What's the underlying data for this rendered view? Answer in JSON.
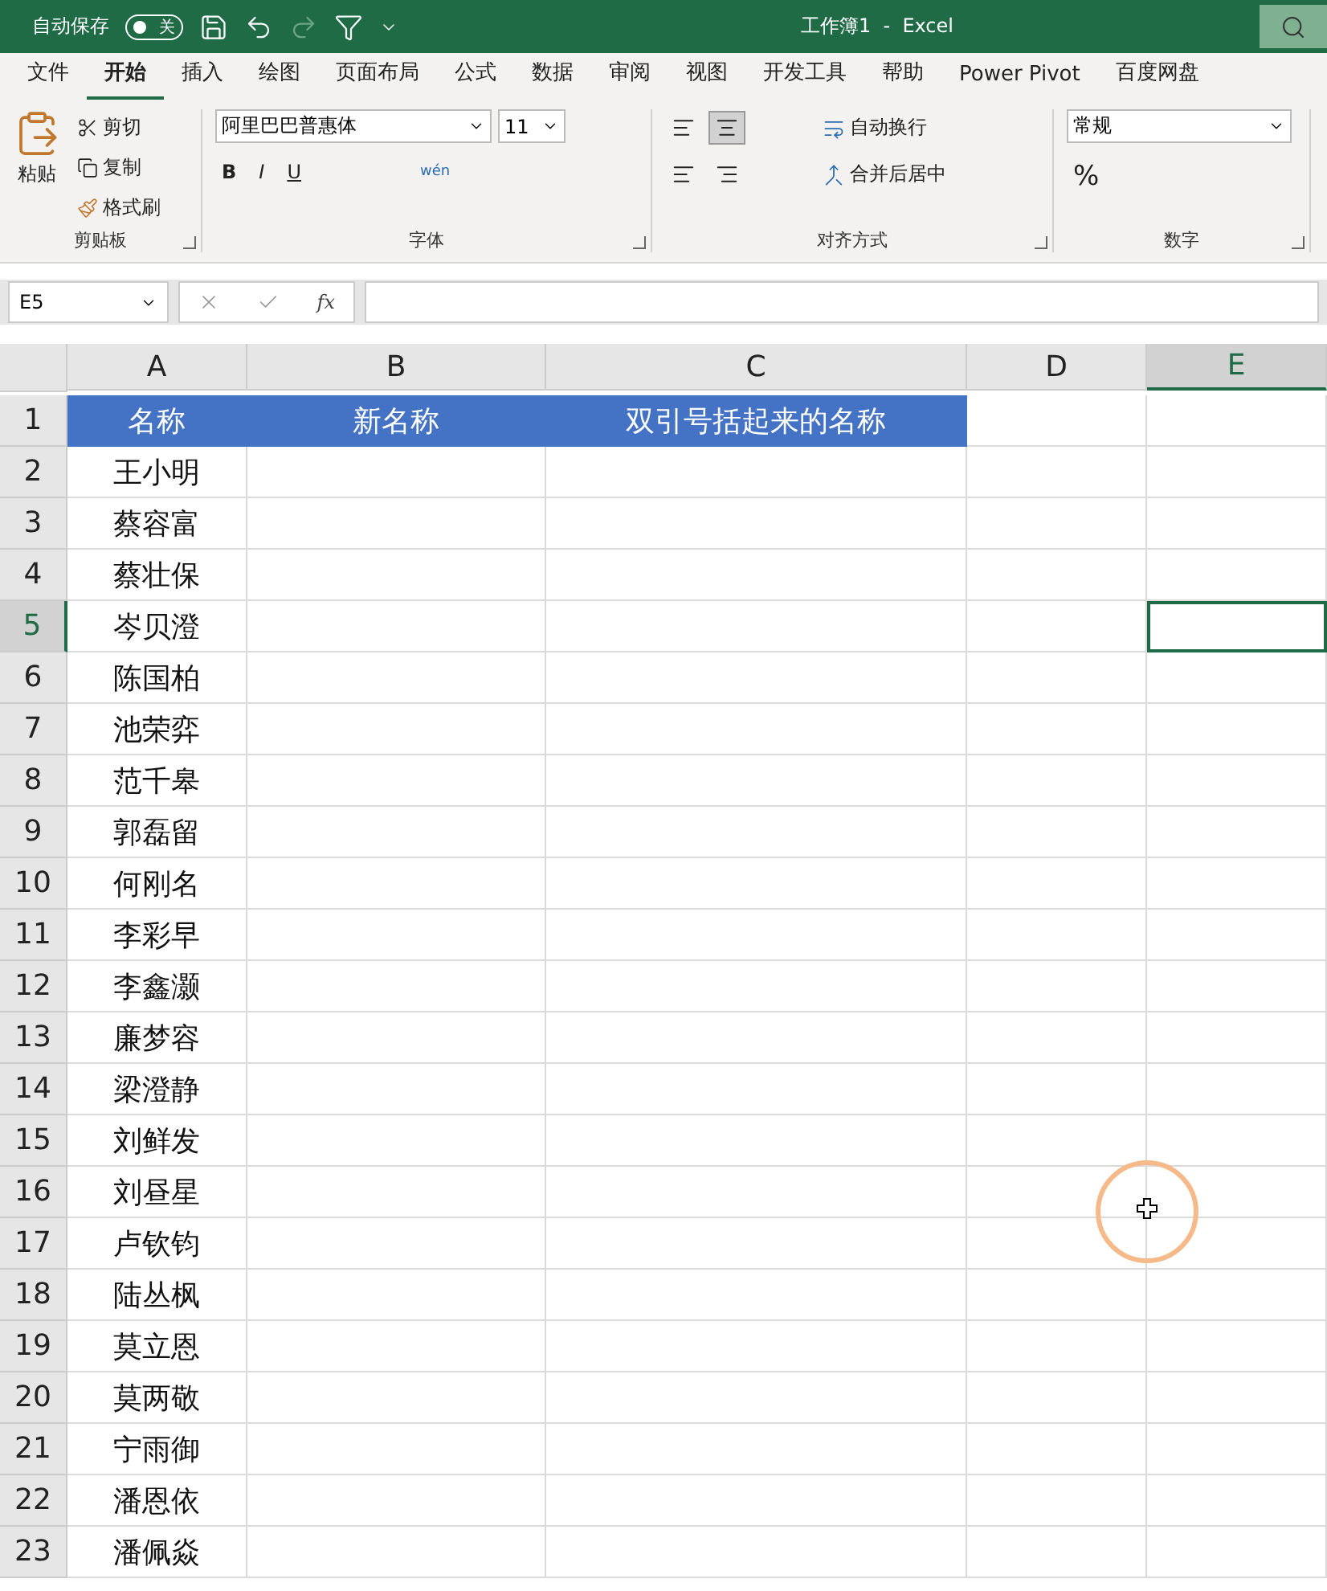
{
  "title_bar": {
    "autosave_label": "自动保存",
    "autosave": {
      "on": false,
      "label": "关"
    },
    "title": "工作簿1  -  Excel"
  },
  "tabs": [
    {
      "label": "文件",
      "selected": false
    },
    {
      "label": "开始",
      "selected": true
    },
    {
      "label": "插入",
      "selected": false
    },
    {
      "label": "绘图",
      "selected": false
    },
    {
      "label": "页面布局",
      "selected": false
    },
    {
      "label": "公式",
      "selected": false
    },
    {
      "label": "数据",
      "selected": false
    },
    {
      "label": "审阅",
      "selected": false
    },
    {
      "label": "视图",
      "selected": false
    },
    {
      "label": "开发工具",
      "selected": false
    },
    {
      "label": "帮助",
      "selected": false
    },
    {
      "label": "Power Pivot",
      "selected": false
    },
    {
      "label": "百度网盘",
      "selected": false
    }
  ],
  "ribbon": {
    "clipboard": {
      "title": "剪贴板",
      "paste": "粘贴",
      "cut": "剪切",
      "copy": "复制",
      "format_painter": "格式刷"
    },
    "font": {
      "title": "字体",
      "font_name": "阿里巴巴普惠体",
      "font_size": "11",
      "bold": "B",
      "italic": "I",
      "underline": "U",
      "phonetic": "wén"
    },
    "alignment": {
      "title": "对齐方式",
      "wrap_text": "自动换行",
      "merge_center": "合并后居中"
    },
    "number": {
      "title": "数字",
      "format": "常规",
      "percent": "%"
    }
  },
  "formula_bar": {
    "name_box": "E5",
    "fx": "fx"
  },
  "columns": [
    {
      "label": "A",
      "selected": false
    },
    {
      "label": "B",
      "selected": false
    },
    {
      "label": "C",
      "selected": false
    },
    {
      "label": "D",
      "selected": false
    },
    {
      "label": "E",
      "selected": true
    }
  ],
  "rows": [
    {
      "number": "1",
      "selected": false,
      "kind": "header",
      "cells": [
        "名称",
        "新名称",
        "双引号括起来的名称"
      ]
    },
    {
      "number": "2",
      "selected": false,
      "kind": "data",
      "cells": [
        "王小明"
      ]
    },
    {
      "number": "3",
      "selected": false,
      "kind": "data",
      "cells": [
        "蔡容富"
      ]
    },
    {
      "number": "4",
      "selected": false,
      "kind": "data",
      "cells": [
        "蔡壮保"
      ]
    },
    {
      "number": "5",
      "selected": true,
      "kind": "data",
      "cells": [
        "岑贝澄"
      ]
    },
    {
      "number": "6",
      "selected": false,
      "kind": "data",
      "cells": [
        "陈国柏"
      ]
    },
    {
      "number": "7",
      "selected": false,
      "kind": "data",
      "cells": [
        "池荣弈"
      ]
    },
    {
      "number": "8",
      "selected": false,
      "kind": "data",
      "cells": [
        "范千皋"
      ]
    },
    {
      "number": "9",
      "selected": false,
      "kind": "data",
      "cells": [
        "郭磊留"
      ]
    },
    {
      "number": "10",
      "selected": false,
      "kind": "data",
      "cells": [
        "何刚名"
      ]
    },
    {
      "number": "11",
      "selected": false,
      "kind": "data",
      "cells": [
        "李彩早"
      ]
    },
    {
      "number": "12",
      "selected": false,
      "kind": "data",
      "cells": [
        "李鑫灏"
      ]
    },
    {
      "number": "13",
      "selected": false,
      "kind": "data",
      "cells": [
        "廉梦容"
      ]
    },
    {
      "number": "14",
      "selected": false,
      "kind": "data",
      "cells": [
        "梁澄静"
      ]
    },
    {
      "number": "15",
      "selected": false,
      "kind": "data",
      "cells": [
        "刘鲜发"
      ]
    },
    {
      "number": "16",
      "selected": false,
      "kind": "data",
      "cells": [
        "刘昼星"
      ]
    },
    {
      "number": "17",
      "selected": false,
      "kind": "data",
      "cells": [
        "卢钦钧"
      ]
    },
    {
      "number": "18",
      "selected": false,
      "kind": "data",
      "cells": [
        "陆丛枫"
      ]
    },
    {
      "number": "19",
      "selected": false,
      "kind": "data",
      "cells": [
        "莫立恩"
      ]
    },
    {
      "number": "20",
      "selected": false,
      "kind": "data",
      "cells": [
        "莫两敬"
      ]
    },
    {
      "number": "21",
      "selected": false,
      "kind": "data",
      "cells": [
        "宁雨御"
      ]
    },
    {
      "number": "22",
      "selected": false,
      "kind": "data",
      "cells": [
        "潘恩依"
      ]
    },
    {
      "number": "23",
      "selected": false,
      "kind": "data",
      "cells": [
        "潘佩焱"
      ]
    }
  ]
}
